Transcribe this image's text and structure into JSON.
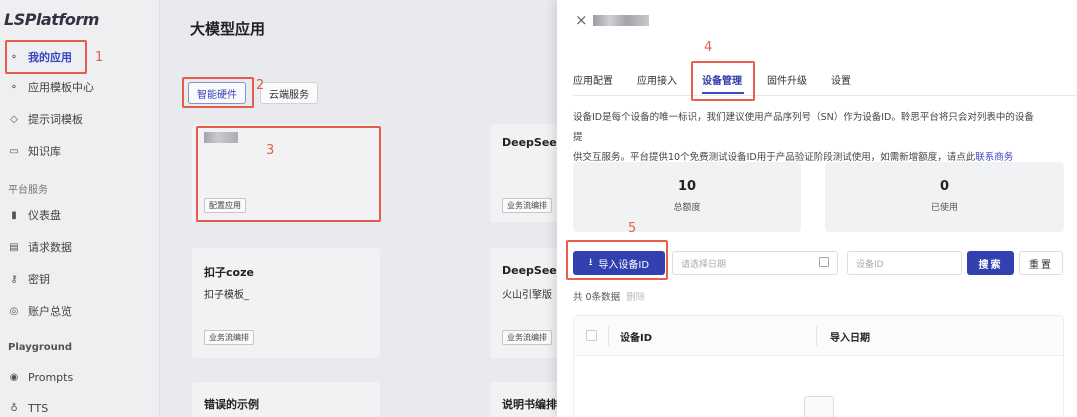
{
  "sidebar": {
    "logo": "LSPlatform",
    "items": [
      {
        "label": "我的应用",
        "icon": "apps-icon"
      },
      {
        "label": "应用模板中心",
        "icon": "template-icon"
      },
      {
        "label": "提示词模板",
        "icon": "cube-icon"
      },
      {
        "label": "知识库",
        "icon": "book-icon"
      }
    ],
    "section_platform": "平台服务",
    "platform_items": [
      {
        "label": "仪表盘",
        "icon": "chart-icon"
      },
      {
        "label": "请求数据",
        "icon": "document-icon"
      },
      {
        "label": "密钥",
        "icon": "key-icon"
      },
      {
        "label": "账户总览",
        "icon": "account-icon"
      }
    ],
    "section_playground": "Playground",
    "playground_items": [
      {
        "label": "Prompts",
        "icon": "prompt-icon"
      },
      {
        "label": "TTS",
        "icon": "mic-icon"
      }
    ]
  },
  "main": {
    "title": "大模型应用",
    "tabs": [
      {
        "label": "智能硬件"
      },
      {
        "label": "云端服务"
      }
    ],
    "cards": [
      {
        "title": "",
        "sub": "",
        "chip": "配置应用"
      },
      {
        "title": "DeepSeek",
        "sub": "",
        "chip": "业务流编排"
      },
      {
        "title": "扣子coze",
        "sub": "扣子模板_",
        "chip": "业务流编排"
      },
      {
        "title": "DeepSeek",
        "sub": "火山引擎版",
        "chip": "业务流编排"
      },
      {
        "title": "错误的示例",
        "sub": "",
        "chip": ""
      },
      {
        "title": "说明书编排",
        "sub": "",
        "chip": ""
      }
    ]
  },
  "annotations": [
    "1",
    "2",
    "3",
    "4",
    "5"
  ],
  "drawer": {
    "close_icon": "×",
    "tabs": [
      "应用配置",
      "应用接入",
      "设备管理",
      "固件升级",
      "设置"
    ],
    "active_tab": "设备管理",
    "description_1": "设备ID是每个设备的唯一标识，我们建议使用产品序列号（SN）作为设备ID。聆思平台将只会对列表中的设备提",
    "description_2": "供交互服务。平台提供10个免费测试设备ID用于产品验证阶段测试使用，如需新增额度，请点此",
    "contact_link": "联系商务",
    "stats": [
      {
        "value": "10",
        "label": "总额度"
      },
      {
        "value": "0",
        "label": "已使用"
      }
    ],
    "import_button": "导入设备ID",
    "date_placeholder": "请选择日期",
    "device_id_placeholder": "设备ID",
    "search_button": "搜索",
    "reset_button": "重置",
    "count_text": "共 0条数据",
    "delete_text": "删除",
    "table_headers": [
      "设备ID",
      "导入日期"
    ]
  }
}
